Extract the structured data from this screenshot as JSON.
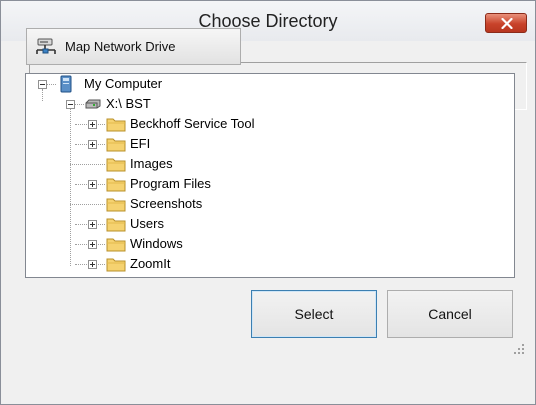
{
  "dialog": {
    "title": "Choose Directory"
  },
  "toolbar": {
    "map_label": "Map Network Drive"
  },
  "tree": {
    "root": {
      "label": "My Computer",
      "icon": "computer-icon"
    },
    "drive": {
      "label": "X:\\ BST",
      "icon": "drive-icon"
    },
    "folders": [
      {
        "label": "Beckhoff Service Tool",
        "expandable": true
      },
      {
        "label": "EFI",
        "expandable": true
      },
      {
        "label": "Images",
        "expandable": false
      },
      {
        "label": "Program Files",
        "expandable": true
      },
      {
        "label": "Screenshots",
        "expandable": false
      },
      {
        "label": "Users",
        "expandable": true
      },
      {
        "label": "Windows",
        "expandable": true
      },
      {
        "label": "ZoomIt",
        "expandable": true
      }
    ]
  },
  "buttons": {
    "select_label": "Select",
    "cancel_label": "Cancel"
  },
  "colors": {
    "close_button": "#c8432b",
    "default_button_border": "#3c7fb1",
    "folder": "#f5d270"
  }
}
